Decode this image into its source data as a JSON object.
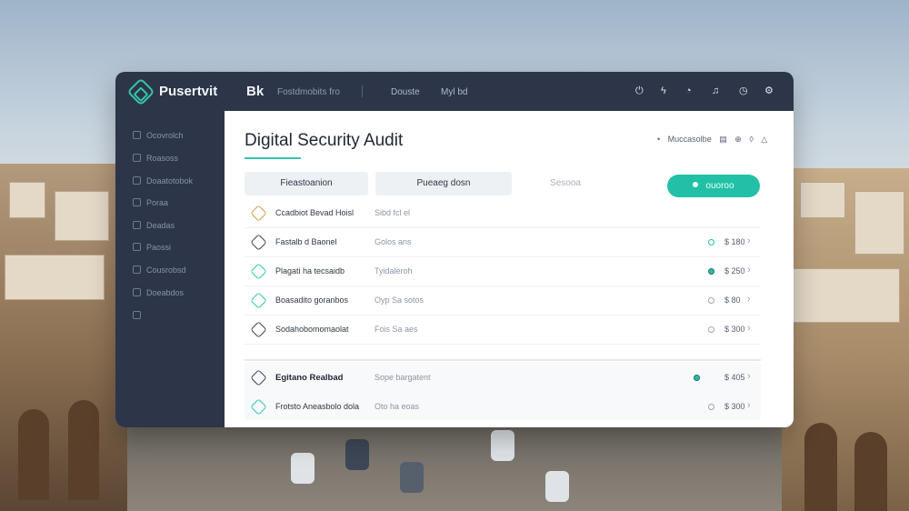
{
  "app": {
    "brand": "Pusertvit",
    "brand_suffix": "Bk",
    "breadcrumb": "Fostdmobits fro",
    "nav": [
      "Douste",
      "Myl bd"
    ]
  },
  "topbar_icons": [
    "power-icon",
    "bolt-icon",
    "bell-icon",
    "music-icon",
    "clock-icon",
    "settings-icon"
  ],
  "sidebar": {
    "items": [
      {
        "label": "Ocovrolch",
        "icon": "grid-icon"
      },
      {
        "label": "Roasoss",
        "icon": "doc-icon"
      },
      {
        "label": "Doaatotobok",
        "icon": "layers-icon"
      },
      {
        "label": "Poraa",
        "icon": "shield-icon"
      },
      {
        "label": "Deadas",
        "icon": "list-icon"
      },
      {
        "label": "Paossi",
        "icon": "user-icon"
      },
      {
        "label": "Cousrobsd",
        "icon": "chart-icon"
      },
      {
        "label": "Doeabdos",
        "icon": "folder-icon"
      },
      {
        "label": "",
        "icon": "lock-icon"
      }
    ]
  },
  "main": {
    "title": "Digital Security Audit",
    "tools": {
      "label": "Muccasolbe",
      "icons": [
        "filter-icon",
        "print-icon",
        "pin-icon",
        "alert-icon"
      ]
    },
    "tabs": [
      "Fieastoanion",
      "Pueaeg dosn",
      "Sesooa"
    ],
    "primary_button": "ouoroo"
  },
  "rows": [
    {
      "name": "Ccadbiot Bevad Hoisl",
      "desc": "Sibd fcl el",
      "value": "",
      "icon": "amber",
      "status": "none",
      "bold": false
    },
    {
      "name": "Fastalb d Baonel",
      "desc": "Golos ans",
      "value": "$ 180",
      "icon": "dark",
      "status": "ok",
      "bold": false
    },
    {
      "name": "Plagati ha tecsaidb",
      "desc": "Tyidaleroh",
      "value": "$ 250",
      "icon": "teal",
      "status": "on",
      "bold": false
    },
    {
      "name": "Boasadito goranbos",
      "desc": "Oyp Sa sotos",
      "value": "$ 80",
      "icon": "teal",
      "status": "none",
      "bold": false
    },
    {
      "name": "Sodahobomomaolat",
      "desc": "Fois Sa aes",
      "value": "$ 300",
      "icon": "dark",
      "status": "none",
      "bold": false
    },
    {
      "name": "Egitano Realbad",
      "desc": "Sope bargatent",
      "value": "$ 405",
      "icon": "dark",
      "status": "on",
      "bold": true
    },
    {
      "name": "Frotsto Aneasbolo dola",
      "desc": "Oto ha eoas",
      "value": "$ 300",
      "icon": "teal",
      "status": "none",
      "bold": false
    }
  ]
}
